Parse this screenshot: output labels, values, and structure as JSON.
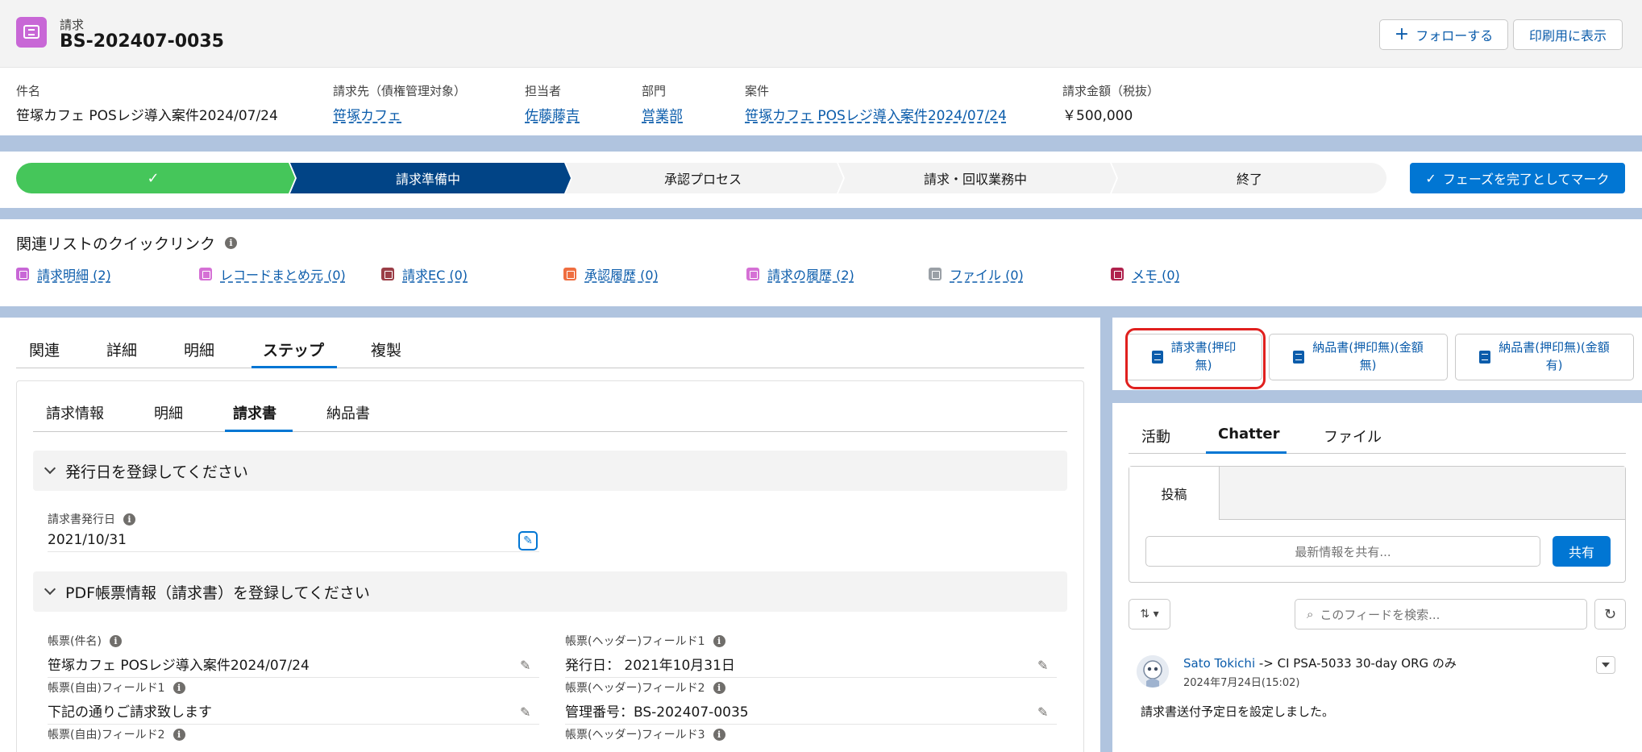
{
  "header": {
    "object_label": "請求",
    "record_title": "BS-202407-0035",
    "follow_label": "フォローする",
    "print_label": "印刷用に表示",
    "fields": [
      {
        "label": "件名",
        "value": "笹塚カフェ POSレジ導入案件2024/07/24"
      },
      {
        "label": "請求先（債権管理対象）",
        "value": "笹塚カフェ"
      },
      {
        "label": "担当者",
        "value": "佐藤藤吉"
      },
      {
        "label": "部門",
        "value": "営業部"
      },
      {
        "label": "案件",
        "value": "笹塚カフェ POSレジ導入案件2024/07/24"
      },
      {
        "label": "請求金額（税抜）",
        "value": "￥500,000"
      }
    ]
  },
  "path": {
    "stages": [
      "",
      "請求準備中",
      "承認プロセス",
      "請求・回収業務中",
      "終了"
    ],
    "mark_complete_label": "フェーズを完了としてマーク",
    "colors": {
      "complete": "#45c65a",
      "current": "#014486",
      "incomplete": "#f3f3f3"
    }
  },
  "quick_links": {
    "title": "関連リストのクイックリンク",
    "items": [
      {
        "label": "請求明細 (2)",
        "color": "#c867d6"
      },
      {
        "label": "レコードまとめ元 (0)",
        "color": "#d570d5"
      },
      {
        "label": "請求EC (0)",
        "color": "#9b3e47"
      },
      {
        "label": "承認履歴 (0)",
        "color": "#ef6e40"
      },
      {
        "label": "請求の履歴 (2)",
        "color": "#d570d5"
      },
      {
        "label": "ファイル (0)",
        "color": "#9aa0a6"
      },
      {
        "label": "メモ (0)",
        "color": "#b0224d"
      }
    ]
  },
  "main_tabs": [
    "関連",
    "詳細",
    "明細",
    "ステップ",
    "複製"
  ],
  "sub_tabs": [
    "請求情報",
    "明細",
    "請求書",
    "納品書"
  ],
  "sections": {
    "issue_date": {
      "title": "発行日を登録してください",
      "field_label": "請求書発行日",
      "field_value": "2021/10/31"
    },
    "pdf": {
      "title": "PDF帳票情報（請求書）を登録してください",
      "fields": [
        {
          "label": "帳票(件名)",
          "value": "笹塚カフェ POSレジ導入案件2024/07/24"
        },
        {
          "label": "帳票(ヘッダー)フィールド1",
          "value": "発行日： 2021年10月31日"
        },
        {
          "label": "帳票(自由)フィールド1",
          "value": "下記の通りご請求致します"
        },
        {
          "label": "帳票(ヘッダー)フィールド2",
          "value": "管理番号：BS-202407-0035"
        },
        {
          "label": "帳票(自由)フィールド2",
          "value": ""
        },
        {
          "label": "帳票(ヘッダー)フィールド3",
          "value": ""
        }
      ]
    }
  },
  "doc_buttons": [
    {
      "line1": "請求書(押印",
      "line2": "無)"
    },
    {
      "line1": "納品書(押印無)(金額",
      "line2": "無)"
    },
    {
      "line1": "納品書(押印無)(金額",
      "line2": "有)"
    }
  ],
  "chatter": {
    "tabs": [
      "活動",
      "Chatter",
      "ファイル"
    ],
    "publisher_tab": "投稿",
    "share_placeholder": "最新情報を共有...",
    "share_button": "共有",
    "search_placeholder": "このフィードを検索...",
    "feed": {
      "author": "Sato Tokichi",
      "target": " -> CI PSA-5033 30-day ORG のみ",
      "time": "2024年7月24日(15:02)",
      "body": "請求書送付予定日を設定しました。"
    }
  }
}
